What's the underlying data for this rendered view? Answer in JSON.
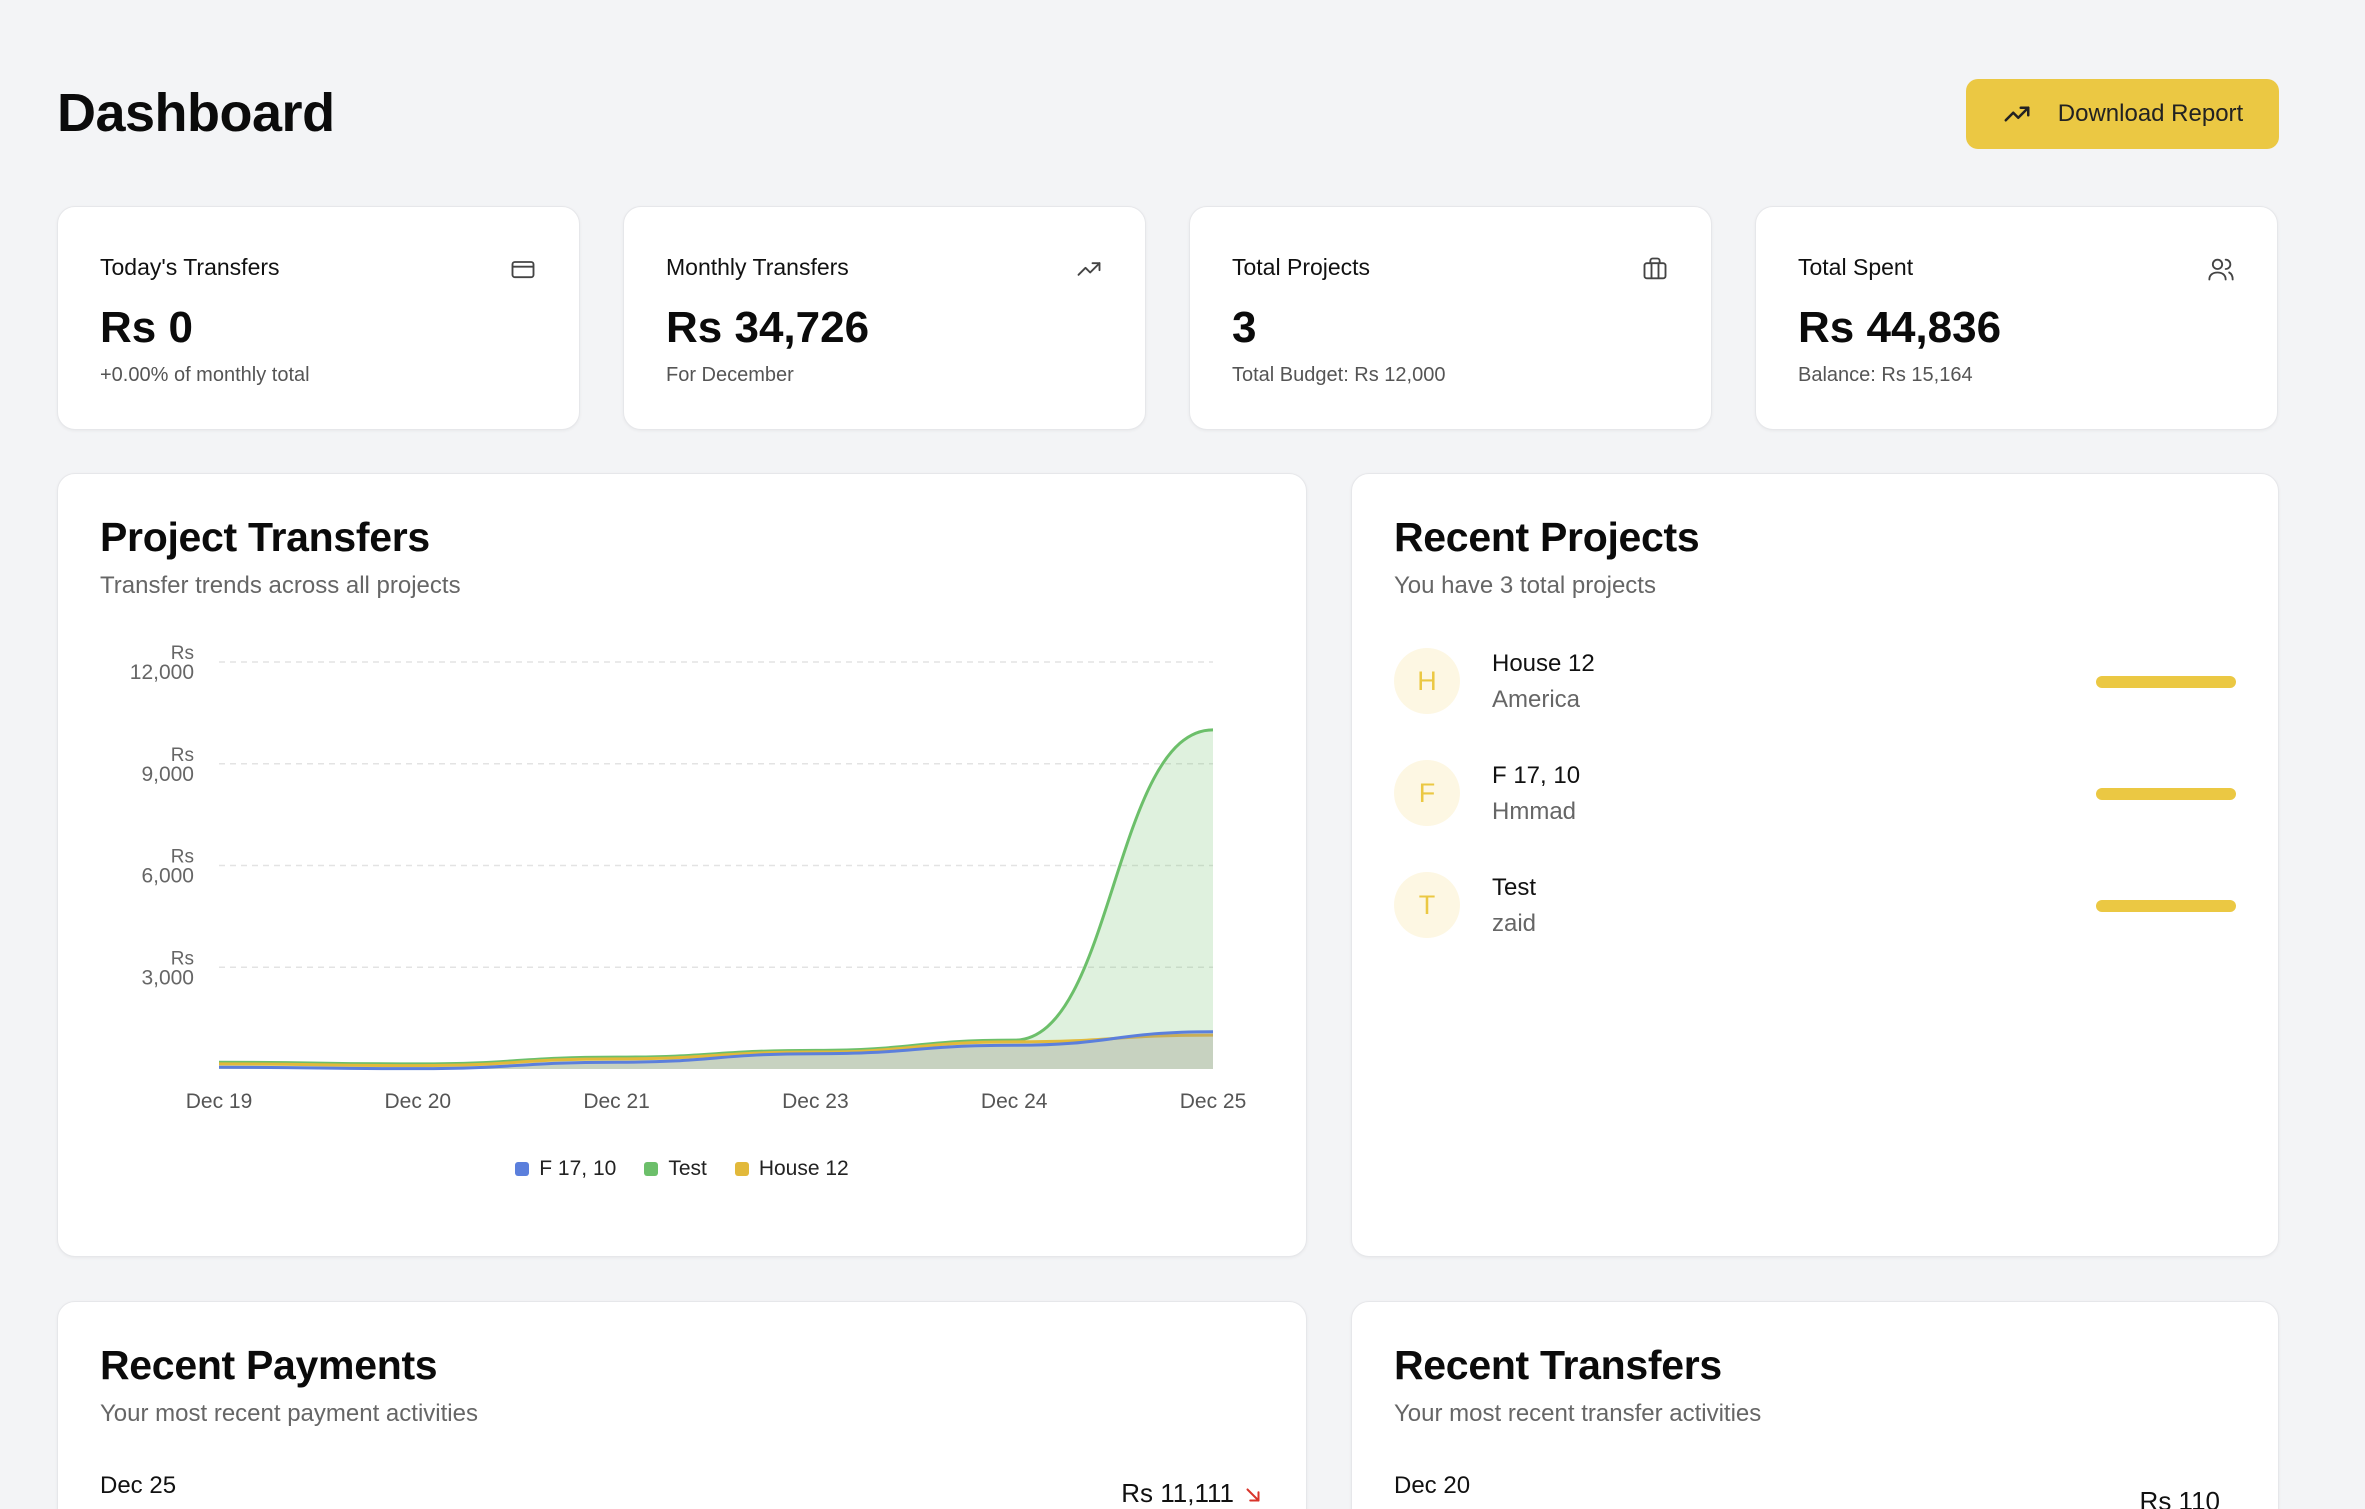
{
  "header": {
    "title": "Dashboard",
    "download_label": "Download Report"
  },
  "stats": [
    {
      "label": "Today's Transfers",
      "value": "Rs 0",
      "sub": "+0.00% of monthly total",
      "icon": "credit-card-icon"
    },
    {
      "label": "Monthly Transfers",
      "value": "Rs 34,726",
      "sub": "For December",
      "icon": "trending-up-icon"
    },
    {
      "label": "Total Projects",
      "value": "3",
      "sub": "Total Budget: Rs 12,000",
      "icon": "briefcase-icon"
    },
    {
      "label": "Total Spent",
      "value": "Rs 44,836",
      "sub": "Balance: Rs 15,164",
      "icon": "users-icon"
    }
  ],
  "project_transfers": {
    "title": "Project Transfers",
    "subtitle": "Transfer trends across all projects"
  },
  "chart_data": {
    "type": "area",
    "x": [
      "Dec 19",
      "Dec 20",
      "Dec 21",
      "Dec 23",
      "Dec 24",
      "Dec 25"
    ],
    "y_ticks": [
      {
        "top": "Rs",
        "bottom": "12,000",
        "value": 12000
      },
      {
        "top": "Rs",
        "bottom": "9,000",
        "value": 9000
      },
      {
        "top": "Rs",
        "bottom": "6,000",
        "value": 6000
      },
      {
        "top": "Rs",
        "bottom": "3,000",
        "value": 3000
      }
    ],
    "ylim": [
      0,
      12000
    ],
    "grid": true,
    "legend_position": "bottom",
    "series": [
      {
        "name": "F 17, 10",
        "color": "#5b7fdc",
        "values": [
          50,
          10,
          200,
          450,
          700,
          1100
        ]
      },
      {
        "name": "Test",
        "color": "#6cbf6a",
        "values": [
          200,
          150,
          350,
          550,
          850,
          10000
        ]
      },
      {
        "name": "House 12",
        "color": "#e2b93b",
        "values": [
          150,
          100,
          300,
          500,
          800,
          1000
        ]
      }
    ]
  },
  "recent_projects": {
    "title": "Recent Projects",
    "subtitle": "You have 3 total projects",
    "items": [
      {
        "initial": "H",
        "name": "House 12",
        "location": "America"
      },
      {
        "initial": "F",
        "name": "F 17, 10",
        "location": "Hmmad"
      },
      {
        "initial": "T",
        "name": "Test",
        "location": "zaid"
      }
    ]
  },
  "recent_payments": {
    "title": "Recent Payments",
    "subtitle": "Your most recent payment activities",
    "first": {
      "date": "Dec 25",
      "amount": "Rs 11,111",
      "icon": "arrow-down-right-icon",
      "color": "#d9342b"
    }
  },
  "recent_transfers": {
    "title": "Recent Transfers",
    "subtitle": "Your most recent transfer activities",
    "first": {
      "date": "Dec 20",
      "amount": "Rs 110"
    }
  }
}
